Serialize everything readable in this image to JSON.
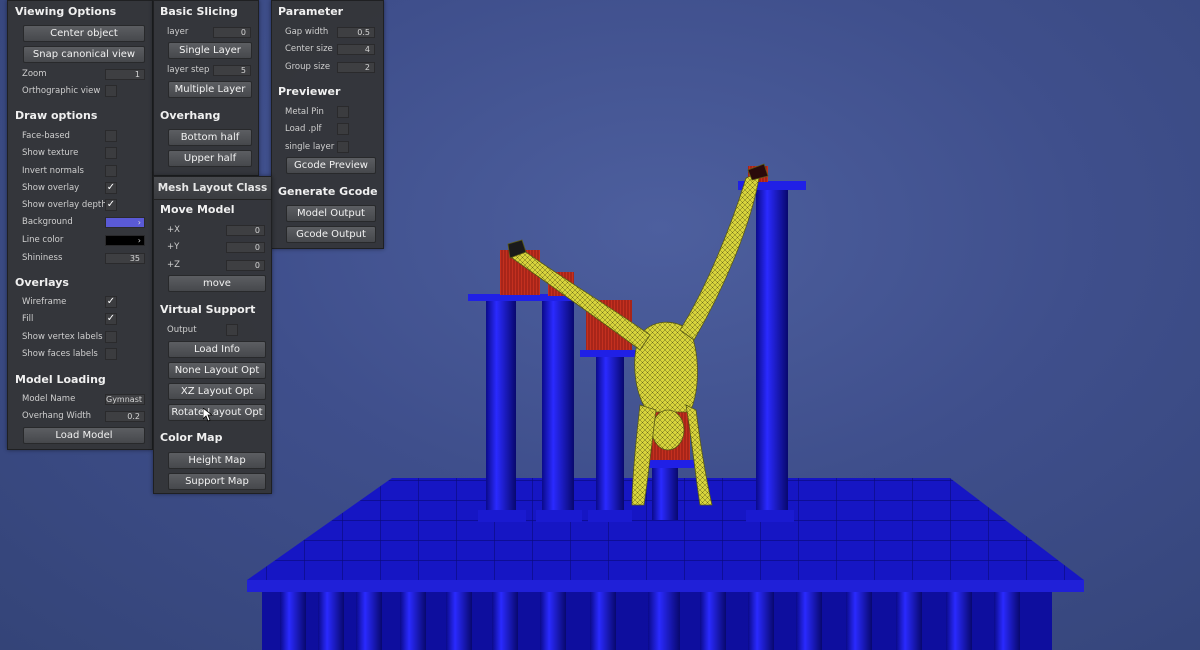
{
  "colors": {
    "background": "#3f4f8c",
    "platform": "#1414c8",
    "model": "#d6d23a",
    "support_red": "#c22a1e",
    "panel": "#343538",
    "background_swatch": "#5a5ad6",
    "line_swatch": "#000000"
  },
  "viewing": {
    "title": "Viewing Options",
    "center_label": "Center object",
    "snap_label": "Snap canonical view",
    "zoom_label": "Zoom",
    "zoom_value": "1",
    "ortho_label": "Orthographic view",
    "draw_title": "Draw options",
    "face_based": "Face-based",
    "show_texture": "Show texture",
    "invert_normals": "Invert normals",
    "show_overlay": "Show overlay",
    "show_overlay_depth": "Show overlay depth",
    "background": "Background",
    "line_color": "Line color",
    "shininess": "Shininess",
    "shininess_value": "35",
    "overlays_title": "Overlays",
    "wireframe": "Wireframe",
    "fill": "Fill",
    "vertex_labels": "Show vertex labels",
    "faces_labels": "Show faces labels",
    "loading_title": "Model Loading",
    "model_name_label": "Model Name",
    "model_name_value": "Gymnast",
    "overhang_width_label": "Overhang Width",
    "overhang_width_value": "0.2",
    "load_model": "Load Model",
    "check": "✓"
  },
  "slicing": {
    "title": "Basic Slicing",
    "layer_label": "layer",
    "layer_value": "0",
    "single_layer": "Single Layer",
    "layer_step_label": "layer step",
    "layer_step_value": "5",
    "multiple_layer": "Multiple Layer",
    "overhang_title": "Overhang",
    "bottom_half": "Bottom half",
    "upper_half": "Upper half"
  },
  "param": {
    "title": "Parameter",
    "gap_label": "Gap width",
    "gap_value": "0.5",
    "center_label": "Center size",
    "center_value": "4",
    "group_label": "Group size",
    "group_value": "2",
    "previewer_title": "Previewer",
    "metal_pin": "Metal Pin",
    "load_plf": "Load .plf",
    "single_layer": "single layer",
    "gcode_preview": "Gcode Preview",
    "generate_title": "Generate Gcode",
    "model_output": "Model Output",
    "gcode_output": "Gcode Output"
  },
  "mesh": {
    "title": "Mesh Layout Class",
    "move_title": "Move Model",
    "x_label": "+X",
    "x_value": "0",
    "y_label": "+Y",
    "y_value": "0",
    "z_label": "+Z",
    "z_value": "0",
    "move": "move",
    "virtual_title": "Virtual Support",
    "output_label": "Output",
    "load_info": "Load Info",
    "none_layout": "None Layout Opt",
    "xz_layout": "XZ Layout Opt",
    "rotate_layout": "Rotate Layout Opt",
    "colormap_title": "Color Map",
    "height_map": "Height Map",
    "support_map": "Support Map"
  }
}
